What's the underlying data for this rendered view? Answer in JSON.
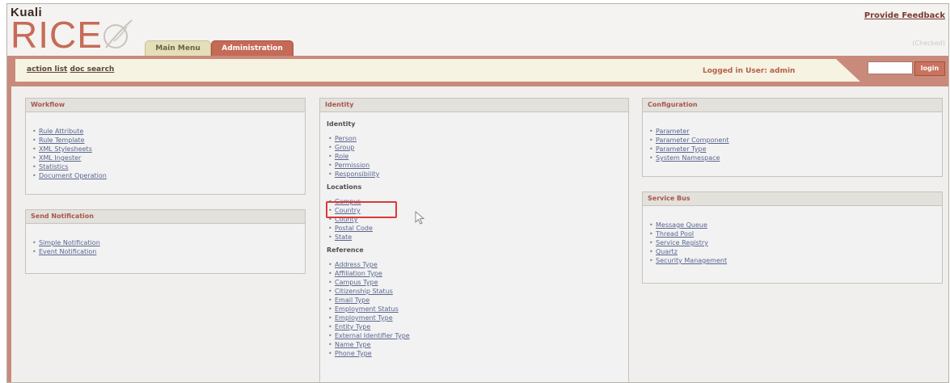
{
  "header": {
    "logo_small": "Kuali",
    "logo_big": "RICE",
    "feedback_link": "Provide Feedback",
    "checked_text": "(Checked)",
    "tabs": [
      {
        "label": "Main Menu",
        "active": false
      },
      {
        "label": "Administration",
        "active": true
      }
    ]
  },
  "toolbar": {
    "action_list": "action list",
    "doc_search": "doc search",
    "logged_in": "Logged in User: admin",
    "login_button": "login"
  },
  "panels": {
    "workflow": {
      "title": "Workflow",
      "items": [
        "Rule Attribute",
        "Rule Template",
        "XML Stylesheets",
        "XML Ingester",
        "Statistics",
        "Document Operation"
      ]
    },
    "send_notification": {
      "title": "Send Notification",
      "items": [
        "Simple Notification",
        "Event Notification"
      ]
    },
    "identity": {
      "title": "Identity",
      "sections": [
        {
          "heading": "Identity",
          "items": [
            "Person",
            "Group",
            "Role",
            "Permission",
            "Responsibility"
          ]
        },
        {
          "heading": "Locations",
          "items": [
            "Campus",
            "Country",
            "County",
            "Postal Code",
            "State"
          ]
        },
        {
          "heading": "Reference",
          "items": [
            "Address Type",
            "Affiliation Type",
            "Campus Type",
            "Citizenship Status",
            "Email Type",
            "Employment Status",
            "Employment Type",
            "Entity Type",
            "External Identifier Type",
            "Name Type",
            "Phone Type"
          ]
        }
      ]
    },
    "configuration": {
      "title": "Configuration",
      "items": [
        "Parameter",
        "Parameter Component",
        "Parameter Type",
        "System Namespace"
      ]
    },
    "service_bus": {
      "title": "Service Bus",
      "items": [
        "Message Queue",
        "Thread Pool",
        "Service Registry",
        "Quartz",
        "Security Management"
      ]
    }
  },
  "colors": {
    "accent": "#c56a57",
    "link": "#5a6690",
    "highlight": "#d93a3a"
  }
}
